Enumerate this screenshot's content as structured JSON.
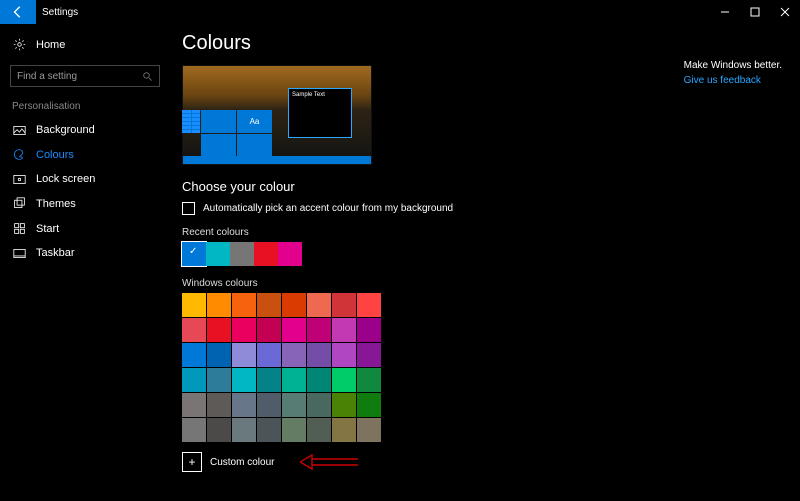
{
  "titlebar": {
    "title": "Settings"
  },
  "sidebar": {
    "home": "Home",
    "search_placeholder": "Find a setting",
    "category": "Personalisation",
    "items": [
      {
        "label": "Background"
      },
      {
        "label": "Colours"
      },
      {
        "label": "Lock screen"
      },
      {
        "label": "Themes"
      },
      {
        "label": "Start"
      },
      {
        "label": "Taskbar"
      }
    ]
  },
  "page": {
    "title": "Colours",
    "preview_sample_text": "Sample Text",
    "preview_tile_aa": "Aa",
    "choose_heading": "Choose your colour",
    "auto_pick_label": "Automatically pick an accent colour from my background",
    "recent_heading": "Recent colours",
    "recent_colours": [
      "#0078d7",
      "#00b7c3",
      "#767676",
      "#e81123",
      "#e3008c"
    ],
    "windows_heading": "Windows colours",
    "windows_colours": [
      "#ffb900",
      "#ff8c00",
      "#f7630c",
      "#ca5010",
      "#da3b01",
      "#ef6950",
      "#d13438",
      "#ff4343",
      "#e74856",
      "#e81123",
      "#ea005e",
      "#c30052",
      "#e3008c",
      "#bf0077",
      "#c239b3",
      "#9a0089",
      "#0078d7",
      "#0063b1",
      "#8e8cd8",
      "#6b69d6",
      "#8764b8",
      "#744da9",
      "#b146c2",
      "#881798",
      "#0099bc",
      "#2d7d9a",
      "#00b7c3",
      "#038387",
      "#00b294",
      "#018574",
      "#00cc6a",
      "#10893e",
      "#7a7574",
      "#5d5a58",
      "#68768a",
      "#515c6b",
      "#567c73",
      "#486860",
      "#498205",
      "#107c10",
      "#767676",
      "#4c4a48",
      "#69797e",
      "#4a5459",
      "#647c64",
      "#525e54",
      "#847545",
      "#7e735f"
    ],
    "custom_label": "Custom colour"
  },
  "right": {
    "better": "Make Windows better.",
    "feedback": "Give us feedback"
  }
}
